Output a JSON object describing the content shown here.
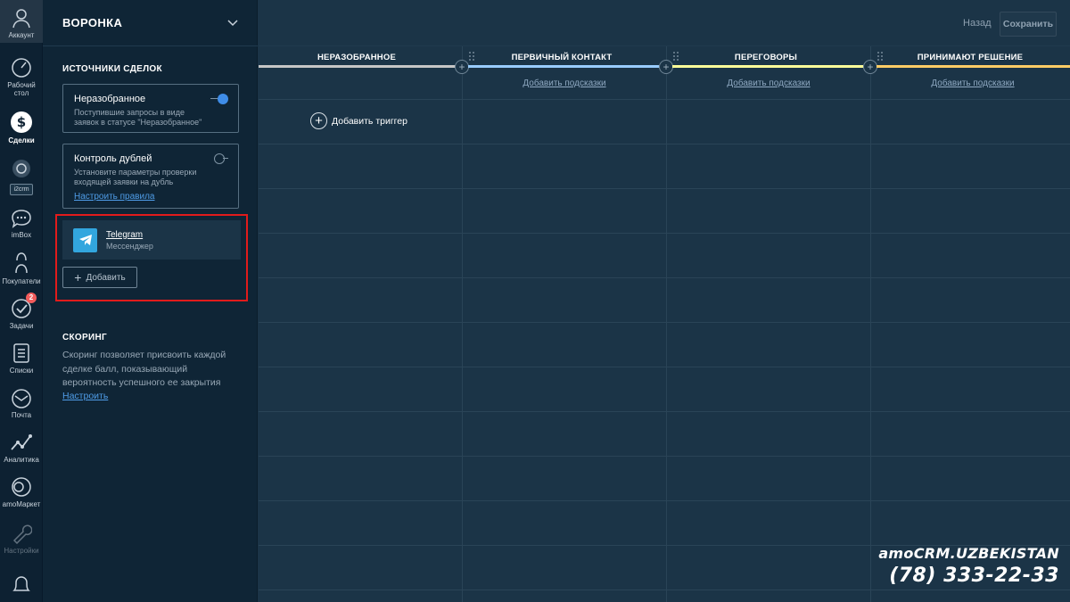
{
  "nav": {
    "items": [
      {
        "label": "Аккаунт",
        "icon": "user-icon"
      },
      {
        "label": "Рабочий стол",
        "icon": "dashboard-icon"
      },
      {
        "label": "Сделки",
        "icon": "deals-dollar-icon"
      },
      {
        "label": "i2crm",
        "icon": "i2crm-icon"
      },
      {
        "label": "imBox",
        "icon": "chat-bubble-icon"
      },
      {
        "label": "Покупатели",
        "icon": "buyers-icon"
      },
      {
        "label": "Задачи",
        "icon": "tasks-check-icon",
        "badge": "2"
      },
      {
        "label": "Списки",
        "icon": "lists-icon"
      },
      {
        "label": "Почта",
        "icon": "mail-icon"
      },
      {
        "label": "Аналитика",
        "icon": "analytics-icon"
      },
      {
        "label": "amoМаркет",
        "icon": "market-icon"
      },
      {
        "label": "Настройки",
        "icon": "settings-wrench-icon"
      },
      {
        "label": "",
        "icon": "notifications-bell-icon"
      }
    ]
  },
  "panel": {
    "title": "ВОРОНКА",
    "sources_title": "ИСТОЧНИКИ СДЕЛОК",
    "sources": [
      {
        "name": "Неразобранное",
        "description": "Поступившие запросы в виде заявок в статусе \"Неразобранное\"",
        "enabled": true
      },
      {
        "name": "Контроль дублей",
        "description": "Установите параметры проверки входящей заявки на дубль",
        "link": "Настроить правила",
        "enabled": false
      }
    ],
    "telegram": {
      "name": "Telegram",
      "type": "Мессенджер"
    },
    "add_button": "Добавить",
    "scoring_title": "СКОРИНГ",
    "scoring_text": "Скоринг позволяет присвоить каждой сделке балл, показывающий вероятность успешного ее закрытия",
    "scoring_link": "Настроить"
  },
  "topbar": {
    "back": "Назад",
    "save": "Сохранить"
  },
  "stages": [
    {
      "title": "НЕРАЗОБРАННОЕ",
      "color": "#c6c6c6",
      "hint": ""
    },
    {
      "title": "ПЕРВИЧНЫЙ КОНТАКТ",
      "color": "#99ccff",
      "hint": "Добавить подсказки"
    },
    {
      "title": "ПЕРЕГОВОРЫ",
      "color": "#ffff99",
      "hint": "Добавить подсказки"
    },
    {
      "title": "ПРИНИМАЮТ РЕШЕНИЕ",
      "color": "#ffcc66",
      "hint": "Добавить подсказки"
    }
  ],
  "trigger": {
    "label": "Добавить триггер"
  },
  "watermark": {
    "brand": "amoCRM.UZBEKISTAN",
    "phone": "(78) 333-22-33"
  },
  "colors": {
    "accent": "#3f8de8",
    "highlight": "#e11b1b",
    "telegram": "#32a6de"
  }
}
